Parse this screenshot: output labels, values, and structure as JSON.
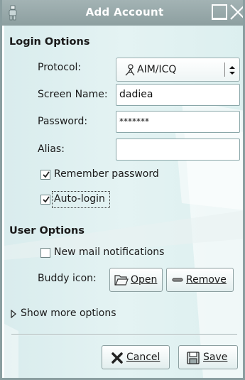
{
  "window": {
    "title": "Add Account"
  },
  "login_options": {
    "heading": "Login Options",
    "protocol_label": "Protocol:",
    "protocol_value": "AIM/ICQ",
    "protocol_icon": "aim-person-icon",
    "screen_name_label": "Screen Name:",
    "screen_name_value": "dadiea",
    "password_label": "Password:",
    "password_value": "*******",
    "alias_label": "Alias:",
    "alias_value": "",
    "remember_password_label": "Remember password",
    "remember_password_checked": true,
    "auto_login_label": "Auto-login",
    "auto_login_checked": true
  },
  "user_options": {
    "heading": "User Options",
    "new_mail_label": "New mail notifications",
    "new_mail_checked": false,
    "buddy_icon_label": "Buddy icon:",
    "open_button_label": "Open",
    "remove_button_label": "Remove"
  },
  "more_options": {
    "label": "Show more options"
  },
  "actions": {
    "cancel_label": "Cancel",
    "save_label": "Save"
  }
}
